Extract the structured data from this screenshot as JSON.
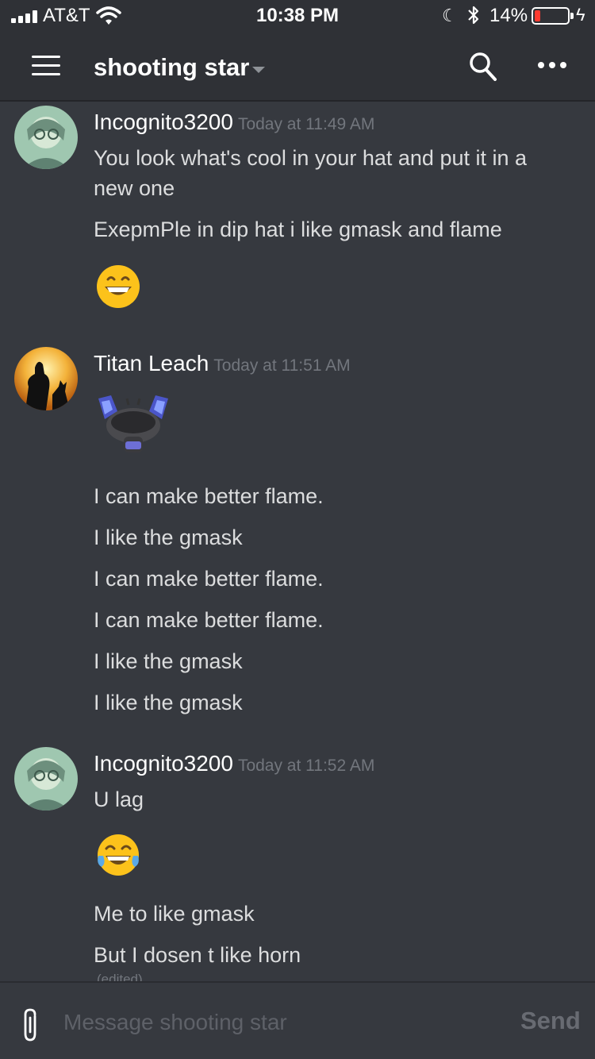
{
  "status_bar": {
    "carrier": "AT&T",
    "time": "10:38 PM",
    "battery_percent": "14%",
    "battery_level": 0.14
  },
  "header": {
    "channel_name": "shooting star",
    "icons": [
      "menu-icon",
      "chevron-down-icon",
      "search-icon",
      "more-icon"
    ]
  },
  "messages": [
    {
      "author": "Incognito3200",
      "timestamp": "Today at 11:49 AM",
      "lines": [
        "You look what's cool in your hat and put it in a new one",
        "ExepmPle in dip hat i like gmask and flame"
      ],
      "emoji": "grinning-face-icon"
    },
    {
      "author": "Titan Leach",
      "timestamp": "Today at 11:51 AM",
      "sticker": "gas-mask-hat-sticker",
      "lines": [
        "I can make better flame.",
        "I like the gmask",
        "I can make better flame.",
        "I can make better flame.",
        "I like the gmask",
        "I like the gmask"
      ]
    },
    {
      "author": "Incognito3200",
      "timestamp": "Today at 11:52 AM",
      "lines": [
        "U lag",
        "Me to like gmask",
        "But I dosen t like horn"
      ],
      "emoji": "tears-of-joy-icon",
      "edited": "(edited)"
    }
  ],
  "composer": {
    "placeholder": "Message shooting star",
    "send_label": "Send"
  },
  "colors": {
    "background": "#36393f",
    "header": "#2f3136",
    "timestamp": "#72767d",
    "battery_low": "#ff3b30"
  }
}
